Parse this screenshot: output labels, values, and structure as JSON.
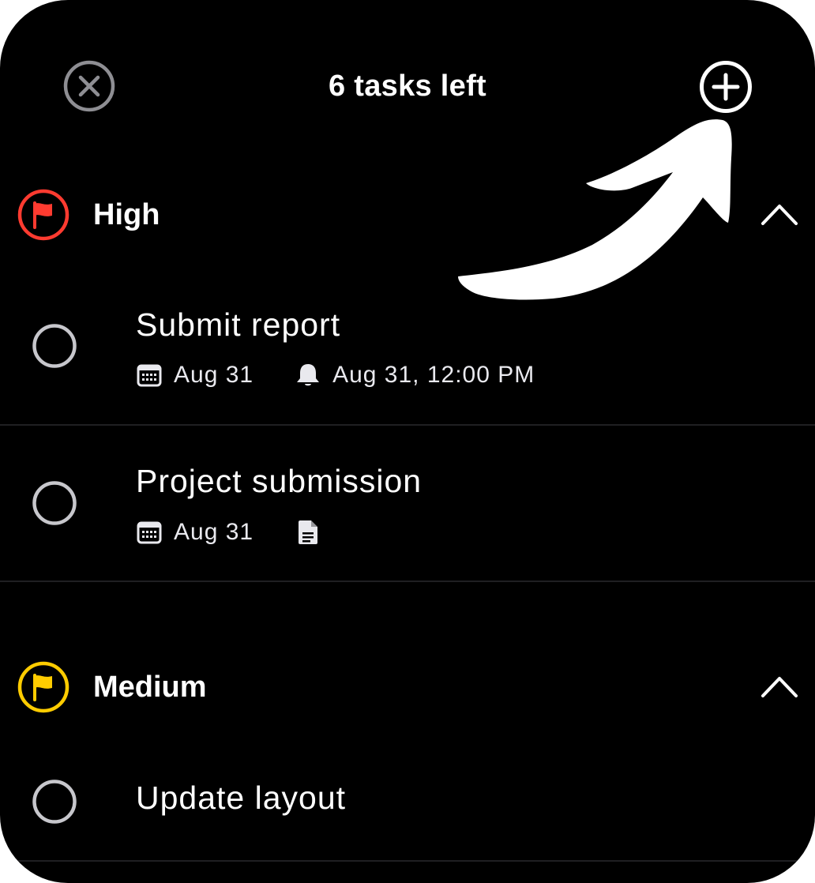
{
  "header": {
    "title": "6 tasks left",
    "close_icon": "close-circle-icon",
    "add_icon": "plus-circle-icon"
  },
  "colors": {
    "background": "#000000",
    "high_flag": "#ff3b30",
    "medium_flag": "#ffcc00",
    "checkbox_ring": "#c7c7cc"
  },
  "sections": [
    {
      "label": "High",
      "flag_icon": "red-flag-icon",
      "expanded": true,
      "tasks": [
        {
          "title": "Submit report",
          "due_date": "Aug 31",
          "reminder": "Aug 31, 12:00 PM",
          "has_note": false
        },
        {
          "title": "Project submission",
          "due_date": "Aug 31",
          "reminder": "",
          "has_note": true
        }
      ]
    },
    {
      "label": "Medium",
      "flag_icon": "yellow-flag-icon",
      "expanded": true,
      "tasks": [
        {
          "title": "Update layout",
          "due_date": "",
          "reminder": "",
          "has_note": false
        }
      ]
    }
  ],
  "annotation": {
    "type": "arrow",
    "points_to": "add-task-button"
  }
}
